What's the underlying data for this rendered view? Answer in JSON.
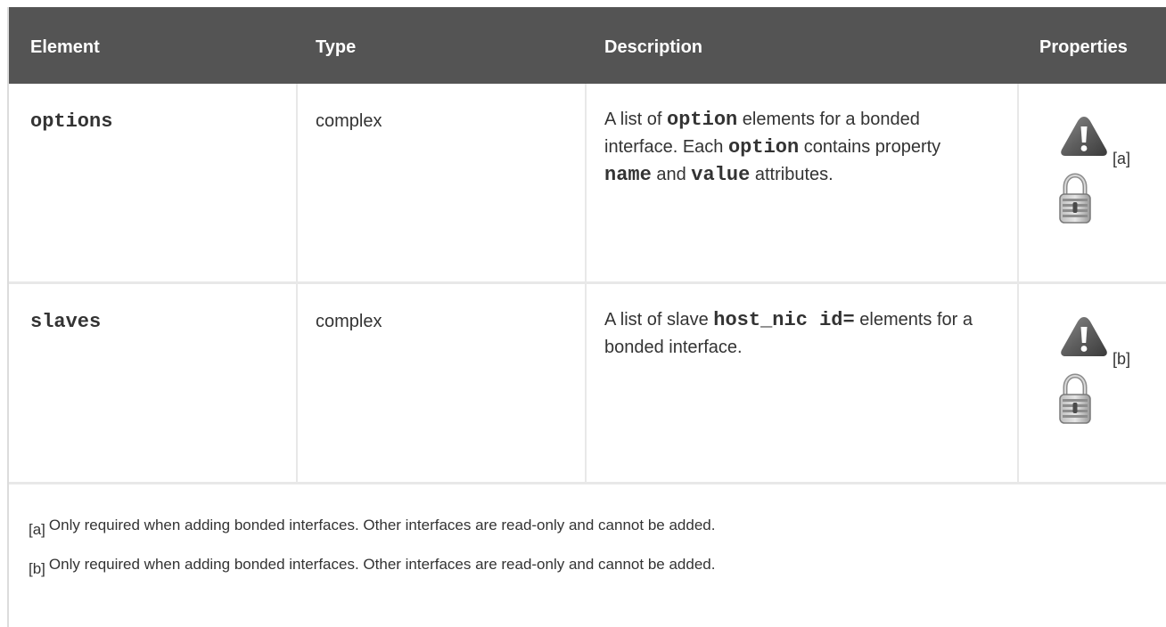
{
  "table": {
    "headers": {
      "element": "Element",
      "type": "Type",
      "description": "Description",
      "properties": "Properties"
    },
    "rows": [
      {
        "element": "options",
        "type": "complex",
        "description": {
          "t1": "A list of ",
          "c1": "option",
          "t2": " elements for a bonded interface. Each ",
          "c2": "option",
          "t3": " contains property ",
          "c3": "name",
          "t4": " and ",
          "c4": "value",
          "t5": " attributes."
        },
        "footnote_ref": "[a]",
        "icons": [
          "warning-icon",
          "lock-icon"
        ]
      },
      {
        "element": "slaves",
        "type": "complex",
        "description": {
          "t1": "A list of slave ",
          "c1": "host_nic id=",
          "t2": " elements for a bonded interface."
        },
        "footnote_ref": "[b]",
        "icons": [
          "warning-icon",
          "lock-icon"
        ]
      }
    ],
    "footnotes": [
      {
        "mark": "[a]",
        "text": "Only required when adding bonded interfaces. Other interfaces are read-only and cannot be added."
      },
      {
        "mark": "[b]",
        "text": "Only required when adding bonded interfaces. Other interfaces are read-only and cannot be added."
      }
    ]
  },
  "colors": {
    "header_bg": "#545454",
    "header_text": "#ffffff",
    "border": "#e8e8e8",
    "text": "#333333"
  }
}
